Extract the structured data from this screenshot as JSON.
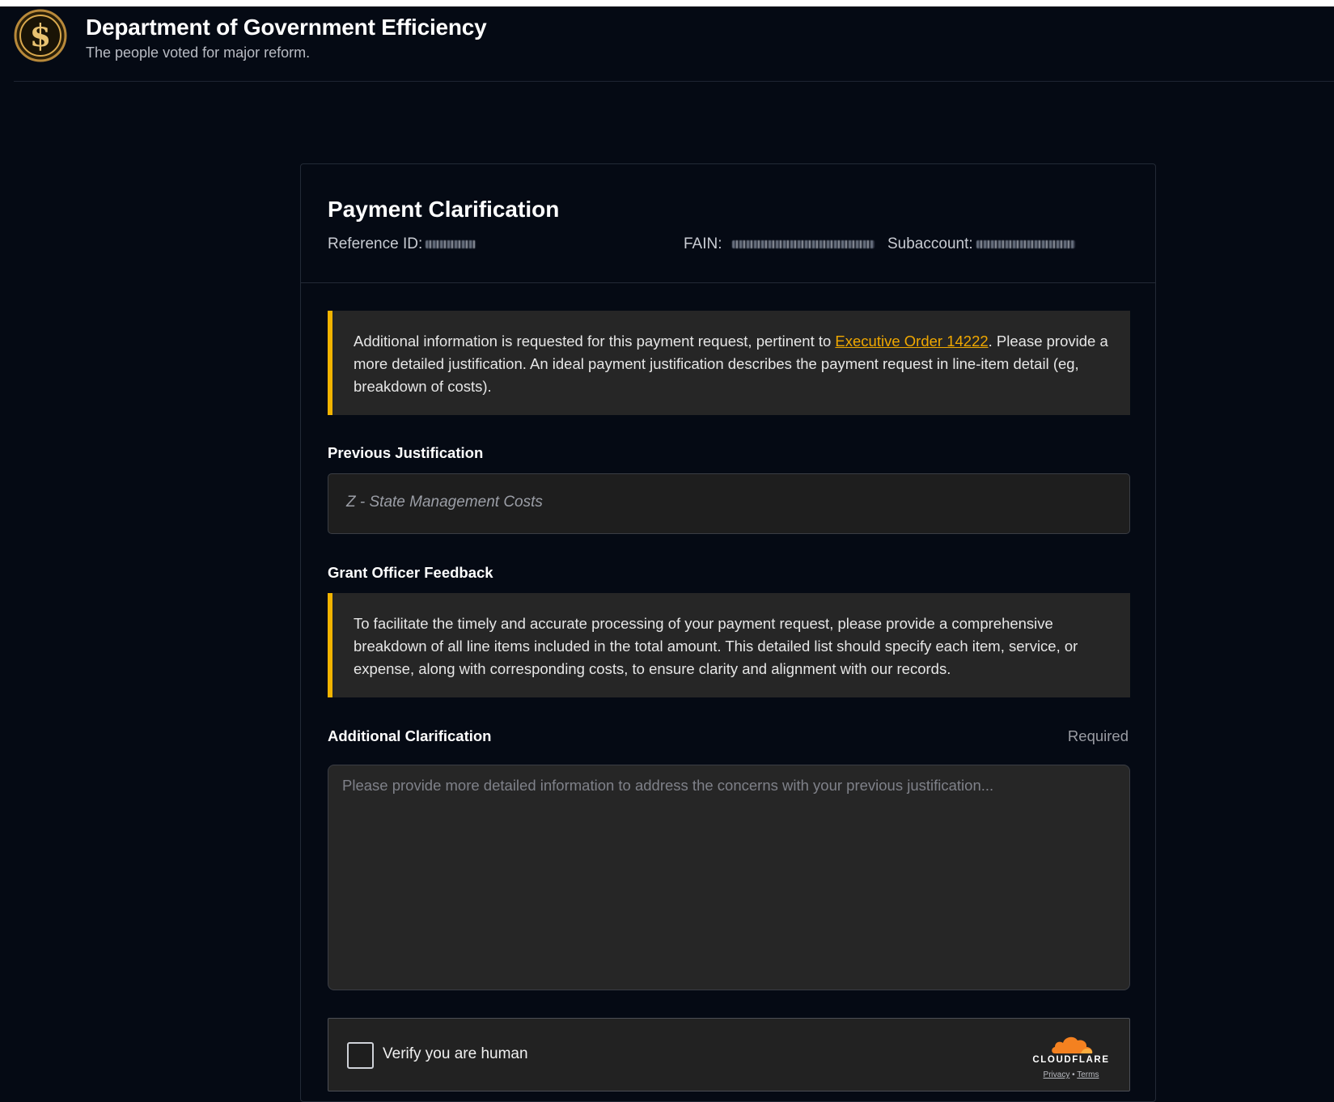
{
  "header": {
    "title": "Department of Government Efficiency",
    "tagline": "The people voted for major reform."
  },
  "card": {
    "title": "Payment Clarification",
    "reference_label": "Reference ID:",
    "fain_label": "FAIN:",
    "subaccount_label": "Subaccount:"
  },
  "notice": {
    "text_before": "Additional information is requested for this payment request, pertinent to ",
    "link_text": "Executive Order 14222",
    "text_after": ". Please provide a more detailed justification. An ideal payment justification describes the payment request in line-item detail (eg, breakdown of costs)."
  },
  "previous_justification": {
    "label": "Previous Justification",
    "value": "Z - State Management Costs"
  },
  "grant_officer_feedback": {
    "label": "Grant Officer Feedback",
    "text": "To facilitate the timely and accurate processing of your payment request, please provide a comprehensive breakdown of all line items included in the total amount. This detailed list should specify each item, service, or expense, along with corresponding costs, to ensure clarity and alignment with our records."
  },
  "additional_clarification": {
    "label": "Additional Clarification",
    "required_label": "Required",
    "placeholder": "Please provide more detailed information to address the concerns with your previous justification...",
    "value": ""
  },
  "captcha": {
    "label": "Verify you are human",
    "brand": "CLOUDFLARE",
    "privacy_label": "Privacy",
    "separator": "•",
    "terms_label": "Terms"
  },
  "colors": {
    "background": "#050a14",
    "accent": "#f2b400",
    "link": "#f0a800",
    "cloudflare_orange": "#f48120"
  }
}
